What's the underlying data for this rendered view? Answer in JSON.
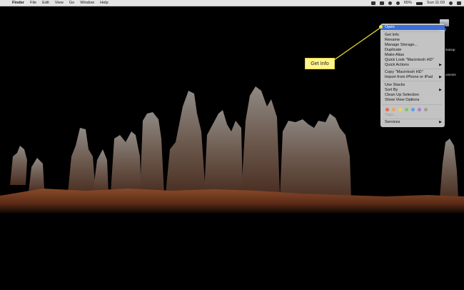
{
  "menubar": {
    "app_name": "Finder",
    "items": [
      "File",
      "Edit",
      "View",
      "Go",
      "Window",
      "Help"
    ],
    "status": {
      "battery_percent": "65%",
      "clock": "Sun 11:03"
    }
  },
  "desktop": {
    "disk_label": "HD",
    "side_labels": [
      "leanup",
      "uments"
    ]
  },
  "context_menu": {
    "items": [
      {
        "label": "Open",
        "highlighted": true
      },
      {
        "label": "Get Info"
      },
      {
        "label": "Rename"
      },
      {
        "label": "Manage Storage..."
      },
      {
        "label": "Duplicate"
      },
      {
        "label": "Make Alias"
      },
      {
        "label": "Quick Look \"Macintosh HD\""
      },
      {
        "label": "Quick Actions",
        "submenu": true
      },
      {
        "label": "Copy \"Macintosh HD\""
      },
      {
        "label": "Import from iPhone or iPad",
        "submenu": true
      },
      {
        "label": "Use Stacks"
      },
      {
        "label": "Sort By",
        "submenu": true
      },
      {
        "label": "Clean Up Selection"
      },
      {
        "label": "Show View Options"
      },
      {
        "label": "Tags...",
        "disabled": true
      },
      {
        "label": "Services",
        "submenu": true
      }
    ],
    "tag_colors": [
      "#e0685d",
      "#f0a35a",
      "#efd15c",
      "#7bc66a",
      "#5aa1e8",
      "#a77fd6",
      "#9c9c9c"
    ],
    "highlight_color": "#3a6fd8"
  },
  "callout": {
    "label": "Get Info",
    "color": "#fff48a"
  }
}
